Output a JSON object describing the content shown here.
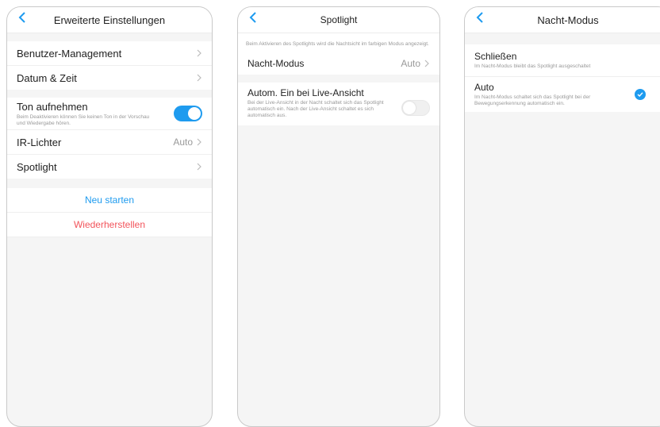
{
  "colors": {
    "accent": "#1e9bef",
    "danger": "#f2545b",
    "muted": "#999999"
  },
  "screen1": {
    "title": "Erweiterte Einstellungen",
    "items": [
      {
        "label": "Benutzer-Management"
      },
      {
        "label": "Datum & Zeit"
      }
    ],
    "record_sound": {
      "label": "Ton aufnehmen",
      "description": "Beim Deaktivieren können Sie keinen Ton in der Vorschau und Wiedergabe hören.",
      "enabled": true
    },
    "ir_lights": {
      "label": "IR-Lichter",
      "value": "Auto"
    },
    "spotlight": {
      "label": "Spotlight"
    },
    "restart_label": "Neu starten",
    "restore_label": "Wiederherstellen"
  },
  "screen2": {
    "title": "Spotlight",
    "note": "Beim Aktivieren des Spotlights wird die Nachtsicht im farbigen Modus angezeigt.",
    "night_mode": {
      "label": "Nacht-Modus",
      "value": "Auto"
    },
    "auto_live": {
      "label": "Autom. Ein bei Live-Ansicht",
      "description": "Bei der Live-Ansicht in der Nacht schaltet sich das Spotlight automatisch ein. Nach der Live-Ansicht schaltet es sich automatisch aus.",
      "enabled": false
    }
  },
  "screen3": {
    "title": "Nacht-Modus",
    "options": [
      {
        "label": "Schließen",
        "description": "Im Nacht-Modus bleibt das Spotlight ausgeschaltet",
        "selected": false
      },
      {
        "label": "Auto",
        "description": "Im Nacht-Modus schaltet sich das Spotlight bei der Bewegungserkennung automatisch ein.",
        "selected": true
      }
    ]
  }
}
